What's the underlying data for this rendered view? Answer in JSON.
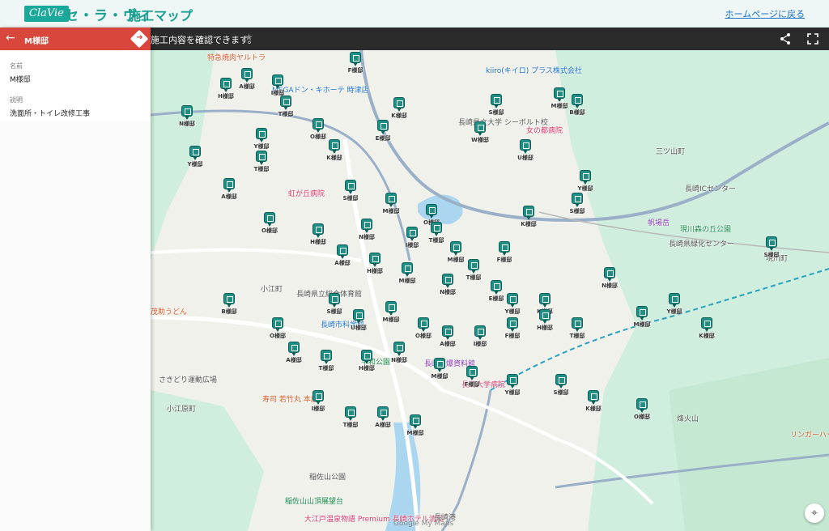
{
  "header": {
    "logo": "ClaVie",
    "brand": "セ・ラ・ヴィ",
    "title": "施工マップ",
    "home_link": "ホームページに戻る"
  },
  "mapbar": {
    "message": "施工内容を確認できます。",
    "star": "★",
    "share_icon": "share-icon",
    "fullscreen_icon": "fullscreen-icon"
  },
  "panel": {
    "title": "M様邸",
    "back": "←",
    "directions": "➜",
    "name_label": "名前",
    "name_value": "M様邸",
    "desc_label": "説明",
    "desc_value": "洗面所・トイレ改修工事"
  },
  "map": {
    "places": [
      {
        "text": "特急焼肉ヤルトラ",
        "color": "#d65b2a"
      },
      {
        "text": "MEGAドン・キホーテ 時津店",
        "color": "#1a73c8"
      },
      {
        "text": "kiiro(キイロ) プラス株式会社",
        "color": "#1a73c8"
      },
      {
        "text": "長崎県立大学 シーボルト校",
        "color": "#555"
      },
      {
        "text": "女の都病院",
        "color": "#d93a6a"
      },
      {
        "text": "虹が丘病院",
        "color": "#d93a6a"
      },
      {
        "text": "長崎県立総合体育館",
        "color": "#555"
      },
      {
        "text": "長崎市科学館",
        "color": "#1a73c8"
      },
      {
        "text": "茂助うどん",
        "color": "#d65b2a"
      },
      {
        "text": "平和公園",
        "color": "#1a8a4a"
      },
      {
        "text": "長崎原爆資料館",
        "color": "#8a3ab9"
      },
      {
        "text": "長崎大学病院",
        "color": "#d93a6a"
      },
      {
        "text": "寿司 若竹丸 本店",
        "color": "#d65b2a"
      },
      {
        "text": "稲佐山公園",
        "color": "#555"
      },
      {
        "text": "稲佐山山頂展望台",
        "color": "#1a8a4a"
      },
      {
        "text": "大江戸温泉物語 Premium 長崎ホテル清風",
        "color": "#d93a6a"
      },
      {
        "text": "帆場岳",
        "color": "#8a3ab9"
      },
      {
        "text": "現川森の丘公園",
        "color": "#1a8a4a"
      },
      {
        "text": "長崎県緑化センター",
        "color": "#555"
      },
      {
        "text": "リンガーハット",
        "color": "#d65b2a"
      },
      {
        "text": "烽火山",
        "color": "#555"
      },
      {
        "text": "三ツ山町",
        "color": "#555"
      },
      {
        "text": "長崎ICセンター",
        "color": "#555"
      },
      {
        "text": "現川町",
        "color": "#555"
      },
      {
        "text": "小江町",
        "color": "#555"
      },
      {
        "text": "小江原町",
        "color": "#555"
      },
      {
        "text": "さきどり運動広場",
        "color": "#555"
      },
      {
        "text": "長崎港",
        "color": "#555"
      }
    ],
    "pins": [
      "F様邸",
      "H様邸",
      "A様邸",
      "I様邸",
      "T様邸",
      "K様邸",
      "Y様邸",
      "O様邸",
      "S様邸",
      "M様邸",
      "N様邸",
      "E様邸",
      "W様邸",
      "U様邸",
      "B様邸",
      "Y様邸",
      "T様邸",
      "K様邸",
      "S様邸",
      "M様邸",
      "O様邸",
      "A様邸",
      "H様邸",
      "N様邸",
      "I様邸",
      "T様邸",
      "M様邸",
      "F様邸",
      "K様邸",
      "Y様邸",
      "S様邸",
      "O様邸",
      "A様邸",
      "H様邸",
      "M様邸",
      "N様邸",
      "T様邸",
      "E様邸",
      "Y様邸",
      "K様邸",
      "S様邸",
      "U様邸",
      "M様邸",
      "O様邸",
      "A様邸",
      "I様邸",
      "F様邸",
      "H様邸",
      "T様邸",
      "N様邸",
      "M様邸",
      "Y様邸",
      "K様邸",
      "S様邸",
      "B様邸",
      "O様邸",
      "A様邸",
      "T様邸",
      "H様邸",
      "N様邸",
      "M様邸",
      "F様邸",
      "Y様邸",
      "S様邸",
      "K様邸",
      "O様邸",
      "I様邸",
      "T様邸",
      "A様邸",
      "M様邸"
    ],
    "zoom_icon": "locate-icon",
    "attribution": "Google My Maps"
  }
}
